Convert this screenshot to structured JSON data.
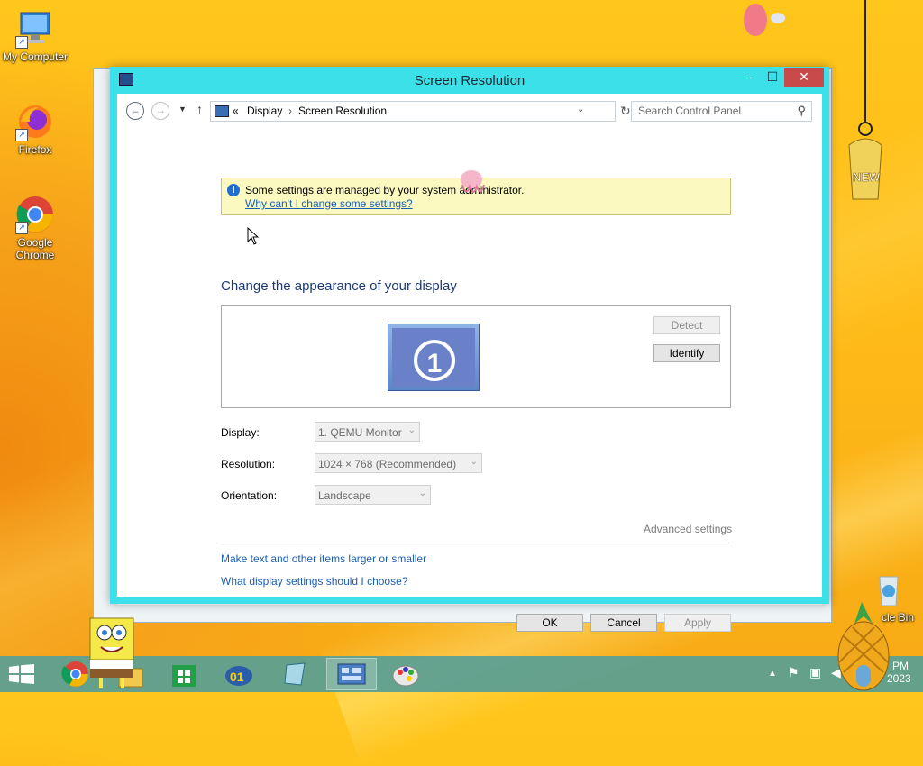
{
  "desktop": {
    "icons": [
      {
        "label": "My Computer"
      },
      {
        "label": "Firefox"
      },
      {
        "label": "Google Chrome"
      },
      {
        "label": "cle Bin"
      }
    ]
  },
  "window": {
    "title": "Screen Resolution",
    "controls": {
      "minimize": "–",
      "maximize": "☐",
      "close": "✕"
    },
    "address": {
      "chevron": "«",
      "crumbs": [
        "Display",
        "Screen Resolution"
      ],
      "separator": "›"
    },
    "search_placeholder": "Search Control Panel",
    "info": {
      "message": "Some settings are managed by your system administrator.",
      "link": "Why can't I change some settings?"
    },
    "heading": "Change the appearance of your display",
    "monitor_number": "1",
    "detect_label": "Detect",
    "identify_label": "Identify",
    "fields": [
      {
        "label": "Display:",
        "value": "1. QEMU Monitor"
      },
      {
        "label": "Resolution:",
        "value": "1024 × 768 (Recommended)"
      },
      {
        "label": "Orientation:",
        "value": "Landscape"
      }
    ],
    "advanced_label": "Advanced settings",
    "links": [
      "Make text and other items larger or smaller",
      "What display settings should I choose?"
    ],
    "buttons": {
      "ok": "OK",
      "cancel": "Cancel",
      "apply": "Apply"
    }
  },
  "taskbar": {
    "clock_time": "PM",
    "clock_date": "2023"
  },
  "colors": {
    "window_frame": "#3be0e8",
    "taskbar": "#58a096",
    "link": "#1a5fb4",
    "heading": "#1e3a73",
    "desktop": "#ffbb18"
  }
}
